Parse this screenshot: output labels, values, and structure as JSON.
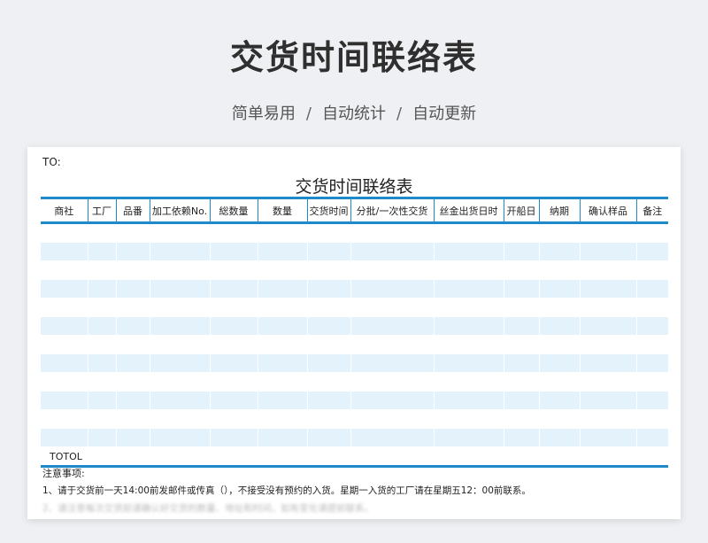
{
  "hero": {
    "title": "交货时间联络表",
    "subtitle_parts": [
      "简单易用",
      "/",
      "自动统计",
      "/",
      "自动更新"
    ]
  },
  "sheet": {
    "to_label": "TO:",
    "title": "交货时间联络表",
    "columns": [
      "商社",
      "工厂",
      "品番",
      "加工依赖No.",
      "総数量",
      "数量",
      "交货时间",
      "分批/一次性交货",
      "丝金出货日时",
      "开船日",
      "纳期",
      "确认样品",
      "备注"
    ],
    "row_count": 12,
    "total_label": "TOTOL",
    "notes_title": "注意事项:",
    "notes": [
      "1、请于交货前一天14:00前发邮件或传真（），不接受没有预约的入货。星期一入货的工厂请在星期五12：00前联系。",
      "2、请注意每次交货前请确认好交货的数量、地址和时间，如有变化请提前联系。"
    ]
  },
  "colors": {
    "accent": "#1f8ac9",
    "row_stripe": "#e4f3fb",
    "background": "#eef0f3"
  }
}
